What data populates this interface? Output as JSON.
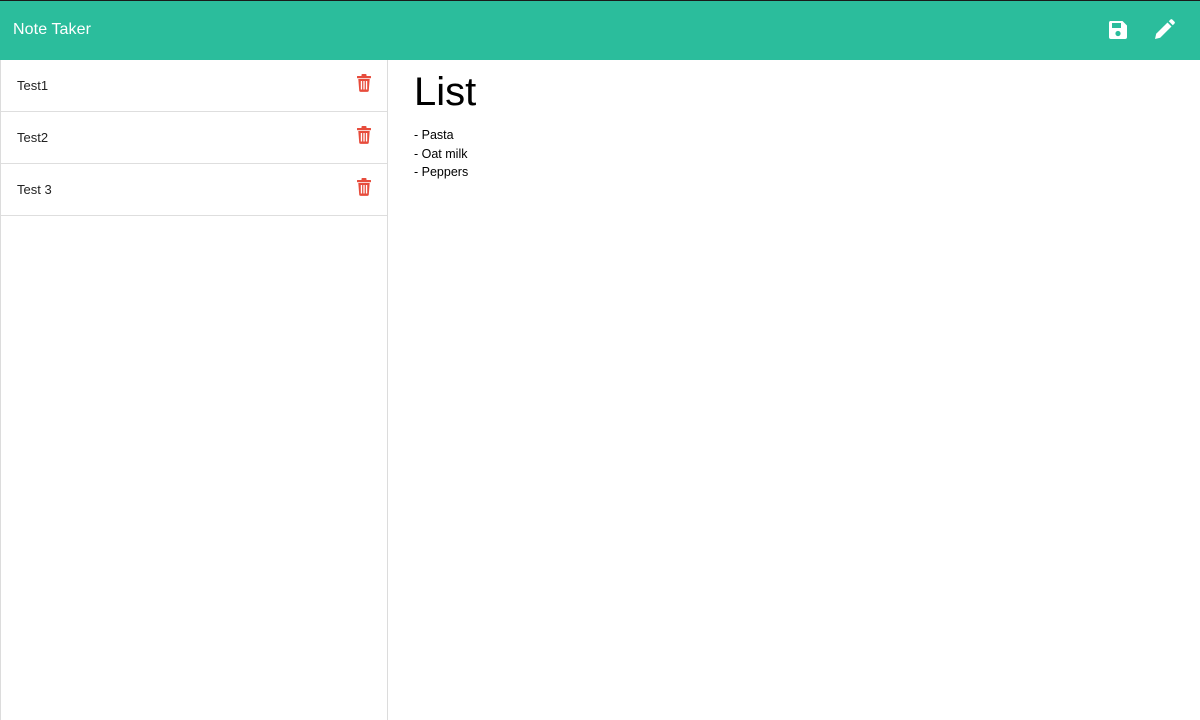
{
  "app": {
    "title": "Note Taker"
  },
  "toolbar": {
    "save_icon": "floppy-disk-icon",
    "new_note_icon": "pencil-icon"
  },
  "sidebar": {
    "items": [
      {
        "label": "Test1",
        "delete_icon": "trash-icon"
      },
      {
        "label": "Test2",
        "delete_icon": "trash-icon"
      },
      {
        "label": "Test 3",
        "delete_icon": "trash-icon"
      }
    ]
  },
  "editor": {
    "title": "List",
    "body": [
      "- Pasta",
      "- Oat milk",
      "- Peppers"
    ]
  },
  "colors": {
    "navbar": "#2bbd9c",
    "delete_icon": "#e74c3c",
    "nav_icons": "#ffffff"
  }
}
